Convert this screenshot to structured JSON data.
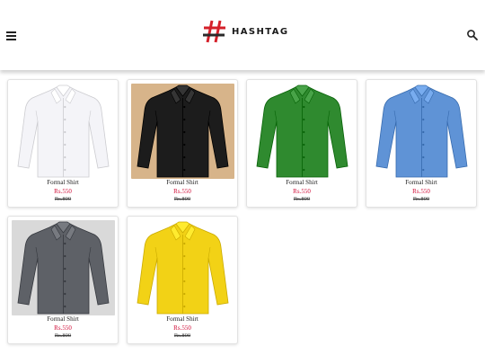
{
  "header": {
    "brand": "HASHTAG",
    "menu_icon": "hamburger-menu-icon",
    "search_icon": "search-icon"
  },
  "products": [
    {
      "name": "Formal Shirt",
      "price": "Rs.550",
      "mrp": "Rs.800",
      "color": "#f4f4f8",
      "bg": "#ffffff"
    },
    {
      "name": "Formal Shirt",
      "price": "Rs.550",
      "mrp": "Rs.800",
      "color": "#1c1c1c",
      "bg": "#d7b48a"
    },
    {
      "name": "Formal Shirt",
      "price": "Rs.550",
      "mrp": "Rs.800",
      "color": "#2f8a2f",
      "bg": "#ffffff"
    },
    {
      "name": "Formal Shirt",
      "price": "Rs.550",
      "mrp": "Rs.800",
      "color": "#5f93d6",
      "bg": "#ffffff"
    },
    {
      "name": "Formal Shirt",
      "price": "Rs.550",
      "mrp": "Rs.800",
      "color": "#5e6167",
      "bg": "#d9d9d9"
    },
    {
      "name": "Formal Shirt",
      "price": "Rs.550",
      "mrp": "Rs.800",
      "color": "#f2d216",
      "bg": "#ffffff"
    }
  ],
  "colors": {
    "price": "#d0103a",
    "logo_red": "#d5202a",
    "logo_dark": "#2a2a2a"
  }
}
